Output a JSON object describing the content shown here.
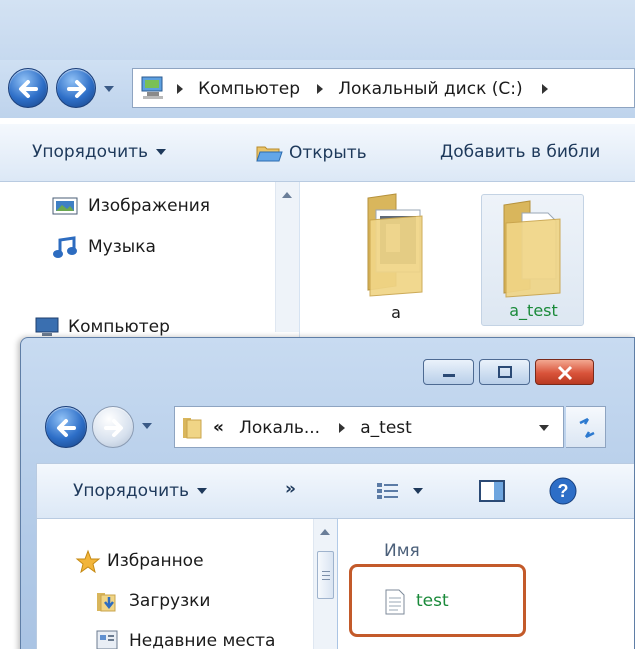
{
  "back_window": {
    "breadcrumb": [
      "Компьютер",
      "Локальный диск (C:)"
    ],
    "toolbar": {
      "organize_label": "Упорядочить",
      "open_label": "Открыть",
      "add_library_label": "Добавить в библи"
    },
    "nav_items": [
      "Изображения",
      "Музыка",
      "Компьютер"
    ],
    "folders": [
      {
        "name": "a"
      },
      {
        "name": "a_test",
        "selected": true
      }
    ]
  },
  "front_window": {
    "address": {
      "overflow": "«",
      "crumbs": [
        "Локаль...",
        "a_test"
      ]
    },
    "toolbar": {
      "organize_label": "Упорядочить",
      "more_label": "»"
    },
    "nav_items": [
      "Избранное",
      "Загрузки",
      "Недавние места"
    ],
    "column_header": "Имя",
    "files": [
      {
        "name": "test",
        "highlighted": true
      }
    ]
  },
  "colors": {
    "highlight_border": "#c35a2a",
    "file_name_green": "#1a8a3a"
  }
}
